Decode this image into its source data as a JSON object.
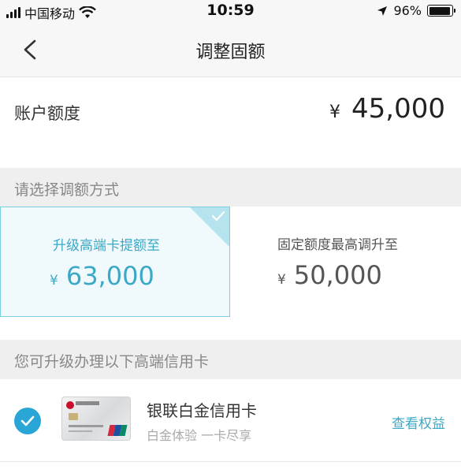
{
  "status_bar": {
    "carrier": "中国移动",
    "time": "10:59",
    "battery": "96%",
    "battery_level": 0.96,
    "signal_icon": "signal-bars-icon",
    "wifi_icon": "wifi-icon",
    "location_icon": "location-arrow-icon",
    "battery_icon": "battery-icon"
  },
  "nav": {
    "title": "调整固额",
    "back_icon": "chevron-left-icon"
  },
  "account": {
    "label": "账户额度",
    "currency": "¥",
    "value": "45,000"
  },
  "method_section": {
    "title": "请选择调额方式"
  },
  "options": [
    {
      "label": "升级高端卡提额至",
      "currency": "¥",
      "value": "63,000",
      "selected": true
    },
    {
      "label": "固定额度最高调升至",
      "currency": "¥",
      "value": "50,000",
      "selected": false
    }
  ],
  "card_section": {
    "title": "您可升级办理以下高端信用卡"
  },
  "card": {
    "name": "银联白金信用卡",
    "description": "白金体验 一卡尽享",
    "link": "查看权益",
    "selected": true
  },
  "colors": {
    "accent": "#3ba8c6",
    "check": "#2aa6d6",
    "section_bg": "#efefef",
    "selected_bg": "#f0fafd",
    "selected_border": "#7ccde2"
  }
}
